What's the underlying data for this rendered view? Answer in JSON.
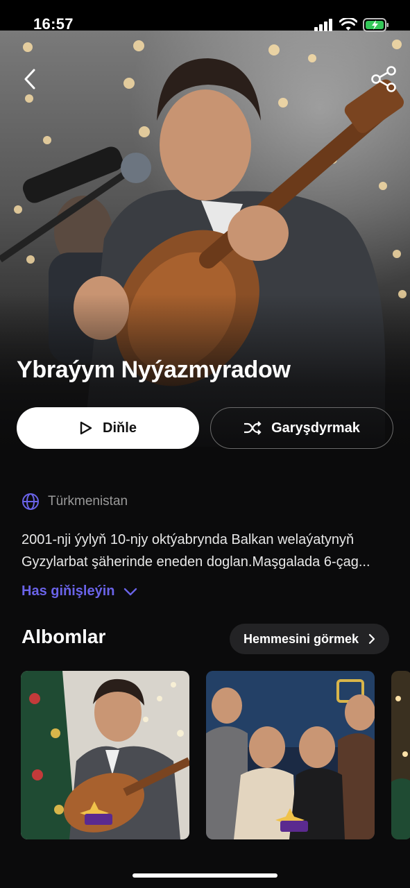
{
  "status_bar": {
    "time": "16:57",
    "icons": [
      "signal-icon",
      "wifi-icon",
      "battery-charging-icon"
    ]
  },
  "header": {
    "back_icon": "chevron-left-icon",
    "share_icon": "share-icon"
  },
  "artist": {
    "name": "Ybraýym Nyýazmyradow",
    "country": "Türkmenistan",
    "bio": "2001-nji ýylyň 10-njy oktýabrynda Balkan welaýatynyň Gyzylarbat şäherinde eneden doglan.Maşgalada 6-çag...",
    "expand_label": "Has giňişleýin"
  },
  "actions": {
    "play_label": "Diňle",
    "shuffle_label": "Garyşdyrmak"
  },
  "albums_section": {
    "title": "Albomlar",
    "see_all_label": "Hemmesini görmek"
  },
  "albums": [
    {
      "logo_text": "ŞÖHLE JANLY SESIM"
    },
    {
      "logo_text": "ŞÖHLE JANLY SESIM"
    },
    {
      "logo_text": ""
    }
  ],
  "colors": {
    "accent": "#6a63e8",
    "background": "#0b0b0c",
    "button_secondary_bg": "#232325"
  }
}
